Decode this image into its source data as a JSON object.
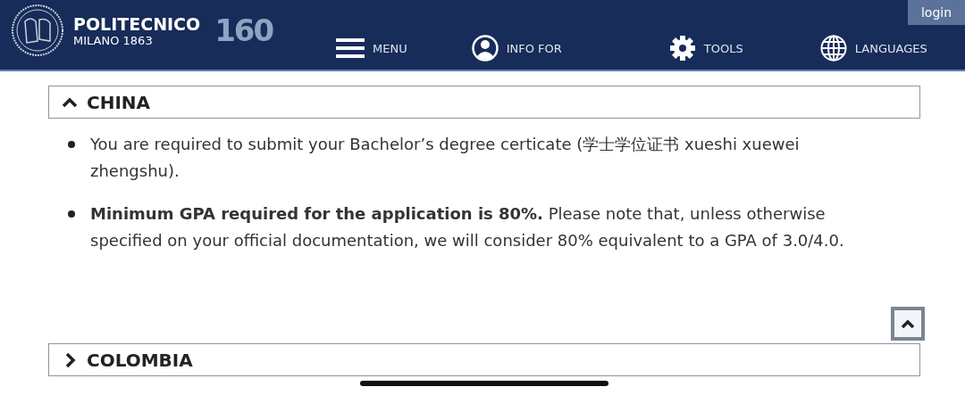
{
  "header": {
    "logo_name": "POLITECNICO",
    "logo_sub": "MILANO 1863",
    "anniversary": "160",
    "login": "login",
    "nav": [
      {
        "label": "MENU",
        "kind": "menu"
      },
      {
        "label": "INFO FOR",
        "kind": "user"
      },
      {
        "label": "TOOLS",
        "kind": "gear"
      },
      {
        "label": "LANGUAGES",
        "kind": "globe"
      }
    ]
  },
  "sections": [
    {
      "title": "CHINA",
      "expanded": true,
      "bullets": [
        "You are required to submit your Bachelor’s degree certicate (学士学位证书 xueshi xuewei zhengshu).",
        "**Minimum GPA required for the application is 80%.** Please note that, unless otherwise specified on your official documentation, we will consider 80% equivalent to a GPA of 3.0/4.0."
      ]
    },
    {
      "title": "COLOMBIA",
      "expanded": false
    }
  ]
}
